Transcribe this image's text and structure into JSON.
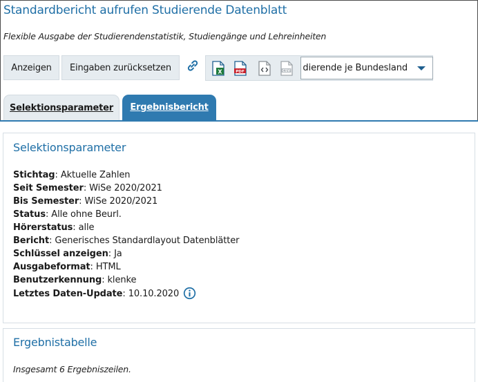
{
  "header": {
    "title": "Standardbericht aufrufen Studierende Datenblatt",
    "subtitle": "Flexible Ausgabe der Studierendenstatistik, Studiengänge und Lehreinheiten"
  },
  "toolbar": {
    "anzeigen_label": "Anzeigen",
    "reset_label": "Eingaben zurücksetzen",
    "icons": [
      "link-icon",
      "excel-icon",
      "pdf-icon",
      "xml-code-icon",
      "csv-icon"
    ],
    "report_select_value": "dierende je Bundesland"
  },
  "tabs": [
    {
      "label": "Selektionsparameter",
      "active": false
    },
    {
      "label": "Ergebnisbericht",
      "active": true
    }
  ],
  "selection": {
    "title": "Selektionsparameter",
    "params": [
      {
        "key": "Stichtag",
        "value": "Aktuelle Zahlen"
      },
      {
        "key": "Seit Semester",
        "value": "WiSe 2020/2021"
      },
      {
        "key": "Bis Semester",
        "value": "WiSe 2020/2021"
      },
      {
        "key": "Status",
        "value": "Alle ohne Beurl."
      },
      {
        "key": "Hörerstatus",
        "value": "alle"
      },
      {
        "key": "Bericht",
        "value": "Generisches Standardlayout Datenblätter"
      },
      {
        "key": "Schlüssel anzeigen",
        "value": "Ja"
      },
      {
        "key": "Ausgabeformat",
        "value": "HTML"
      },
      {
        "key": "Benutzerkennung",
        "value": "klenke"
      },
      {
        "key": "Letztes Daten-Update",
        "value": "10.10.2020"
      }
    ]
  },
  "results": {
    "title": "Ergebnistabelle",
    "summary": "Insgesamt 6 Ergebniszeilen."
  },
  "colors": {
    "accent": "#1f6fa6",
    "tab_active": "#2f7ab0",
    "button_bg": "#e6ecf0",
    "excel": "#1e7a3c",
    "pdf": "#c8202a"
  }
}
